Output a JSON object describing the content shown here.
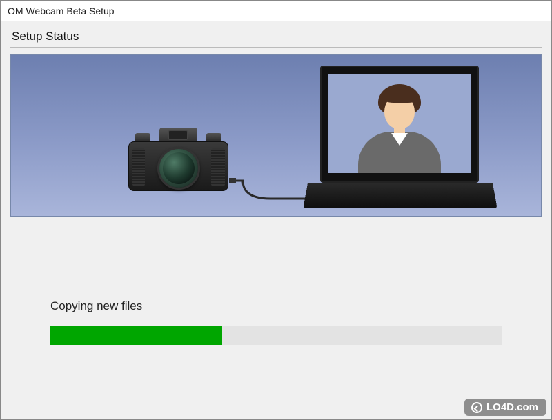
{
  "window": {
    "title": "OM Webcam Beta Setup"
  },
  "content": {
    "section_title": "Setup Status",
    "progress_label": "Copying new files",
    "progress_percent": 38
  },
  "illustration": {
    "camera_icon": "camera-icon",
    "laptop_icon": "laptop-icon",
    "person_icon": "person-avatar-icon",
    "cable_icon": "usb-cable-icon"
  },
  "colors": {
    "progress_fill": "#00a600",
    "progress_track": "#e3e3e3",
    "illustration_bg_top": "#6d7fb0",
    "illustration_bg_bottom": "#a9b5da"
  },
  "watermark": {
    "text": "LO4D.com"
  }
}
